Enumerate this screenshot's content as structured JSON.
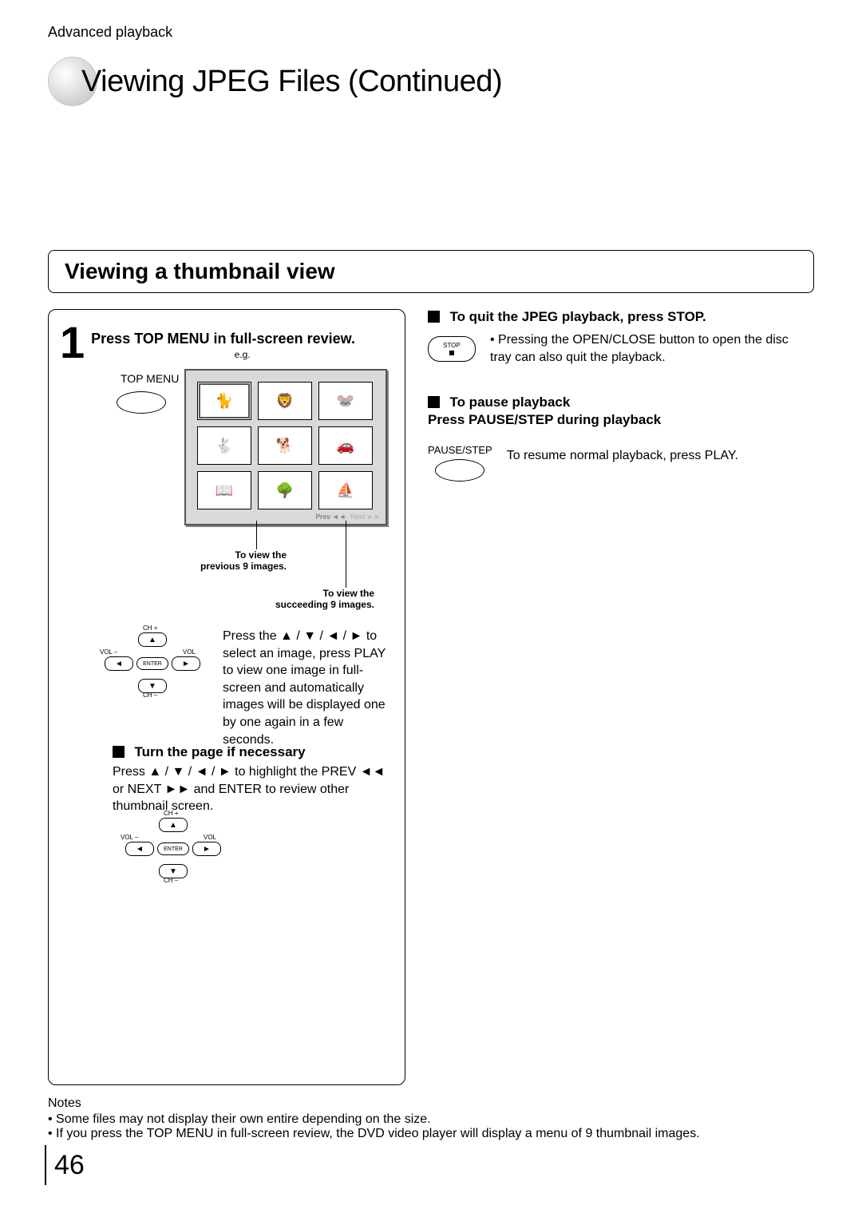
{
  "header": {
    "section": "Advanced playback"
  },
  "title": "Viewing JPEG Files (Continued)",
  "subheading": "Viewing a thumbnail view",
  "step1": {
    "num": "1",
    "title": "Press TOP MENU in full-screen review.",
    "eg": "e.g.",
    "topmenu_label": "TOP MENU",
    "prev_label": "Prev ◄◄",
    "next_label": "Next ►►",
    "prev_caption": "To view the\nprevious 9 images.",
    "next_caption": "To view the\nsucceeding 9 images.",
    "select_text": "Press the ▲ / ▼ / ◄ / ► to select an image, press PLAY to view one image in full-screen and automatically images will be displayed one by one again in a few seconds."
  },
  "dpad": {
    "chp": "CH +",
    "chm": "CH –",
    "volm": "VOL –",
    "volp": "VOL +",
    "enter": "ENTER",
    "up": "▲",
    "down": "▼",
    "left": "◄",
    "right": "►"
  },
  "turn_page": {
    "heading": "Turn the page if necessary",
    "body": "Press  ▲ / ▼ / ◄ / ► to highlight the PREV ◄◄ or NEXT ►►  and ENTER to review other thumbnail screen."
  },
  "right": {
    "quit_heading": "To quit the JPEG playback, press STOP.",
    "stop_label": "STOP",
    "quit_body": "Pressing the OPEN/CLOSE button to open the disc tray can also quit the playback.",
    "pause_heading": "To pause playback",
    "pause_sub": "Press PAUSE/STEP during playback",
    "pausestep_label": "PAUSE/STEP",
    "pause_body": "To resume normal playback, press PLAY."
  },
  "notes": {
    "heading": "Notes",
    "items": [
      "Some files may not display their own entire depending on the size.",
      "If you press the TOP MENU in full-screen review, the DVD video player will display a menu of 9 thumbnail images."
    ]
  },
  "page_number": "46"
}
